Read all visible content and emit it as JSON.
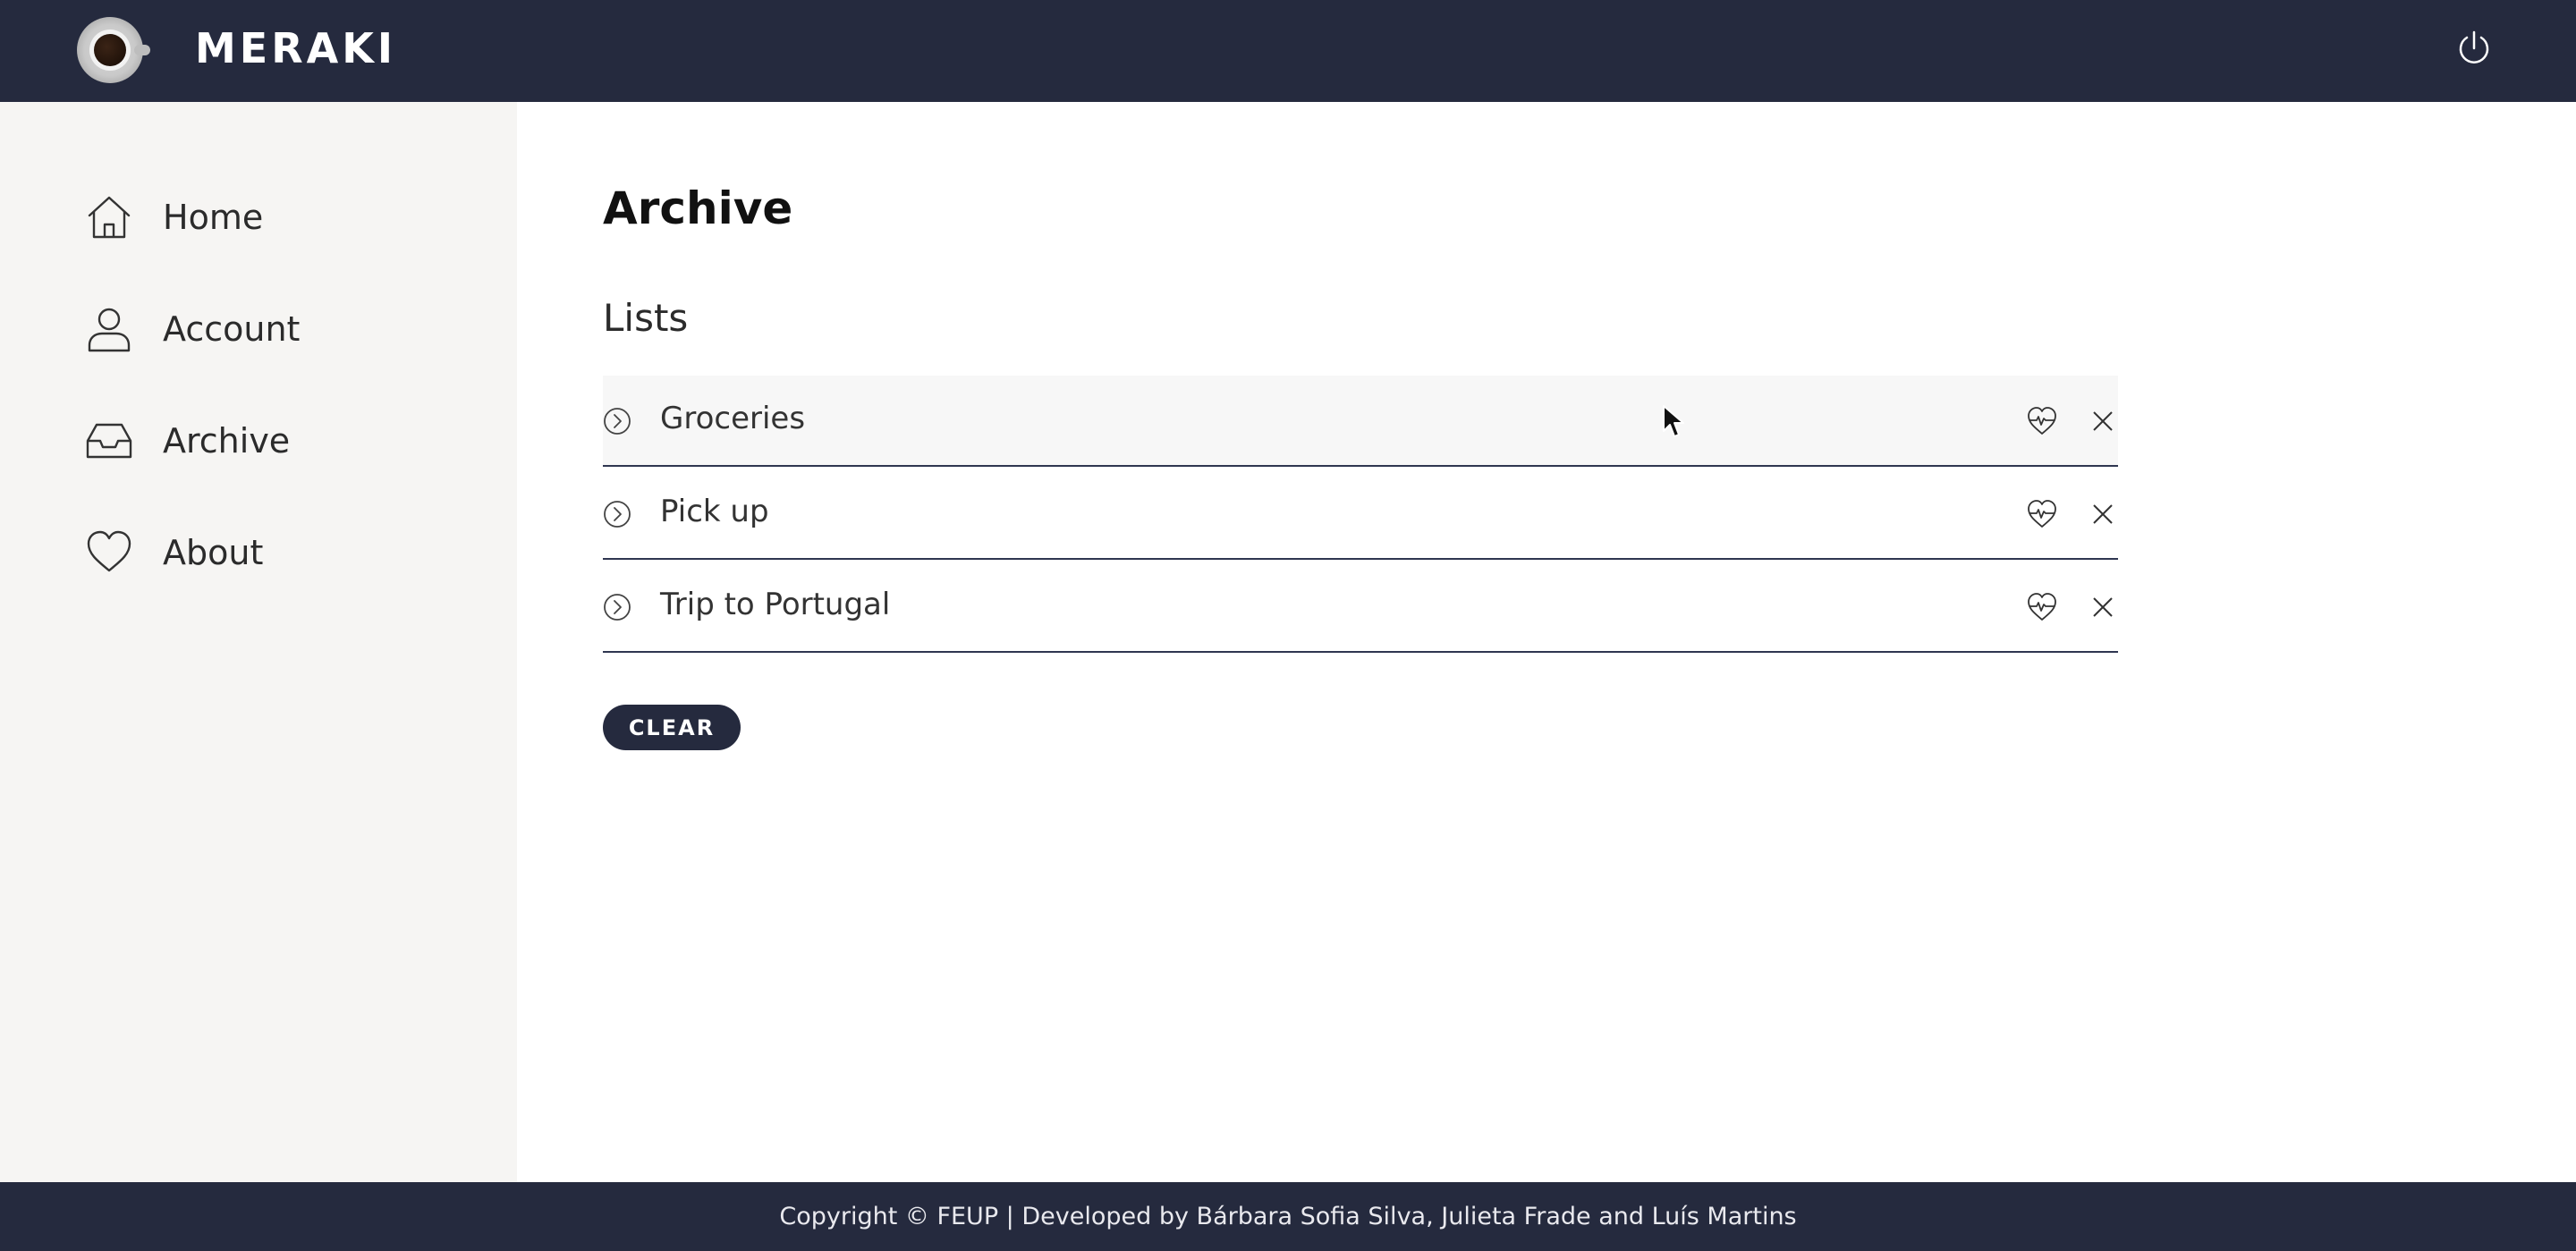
{
  "header": {
    "brand": "MERAKI",
    "logo_icon": "coffee-cup-logo",
    "power_icon": "power-icon"
  },
  "sidebar": {
    "items": [
      {
        "label": "Home",
        "icon": "home-icon"
      },
      {
        "label": "Account",
        "icon": "user-icon"
      },
      {
        "label": "Archive",
        "icon": "inbox-icon"
      },
      {
        "label": "About",
        "icon": "heart-icon"
      }
    ]
  },
  "main": {
    "title": "Archive",
    "section_title": "Lists",
    "lists": [
      {
        "name": "Groceries"
      },
      {
        "name": "Pick up"
      },
      {
        "name": "Trip to Portugal"
      }
    ],
    "clear_label": "CLEAR"
  },
  "footer": {
    "text": "Copyright © FEUP | Developed by Bárbara Sofia Silva, Julieta Frade and Luís Martins"
  },
  "colors": {
    "navy": "#252a3e",
    "sidebar_bg": "#f6f5f3",
    "divider": "#2f3650"
  }
}
